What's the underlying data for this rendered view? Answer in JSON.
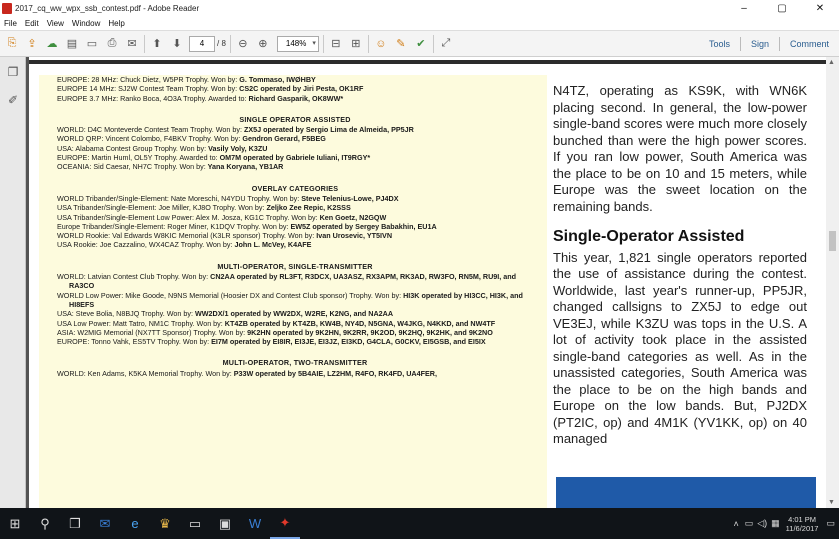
{
  "window": {
    "title": "2017_cq_ww_wpx_ssb_contest.pdf - Adobe Reader",
    "controls": [
      "–",
      "▢",
      "✕"
    ]
  },
  "menu": [
    "File",
    "Edit",
    "View",
    "Window",
    "Help"
  ],
  "toolbar": {
    "page_current": "4",
    "page_total": "/ 8",
    "zoom": "148%",
    "right": [
      "Tools",
      "Sign",
      "Comment"
    ]
  },
  "doc": {
    "left_lines": [
      {
        "type": "line",
        "text": "EUROPE: 28 MHz: Chuck Dietz, W5PR Trophy. Won by: G. Tommaso, IWØHBY"
      },
      {
        "type": "line",
        "text": "EUROPE 14 MHz: SJ2W Contest Team Trophy. Won by: CS2C operated by Jiri Pesta, OK1RF"
      },
      {
        "type": "line",
        "text": "EUROPE 3.7 MHz: Ranko Boca, 4O3A Trophy. Awarded to: Richard Gasparik, OK8WW*"
      },
      {
        "type": "head",
        "text": "SINGLE OPERATOR ASSISTED"
      },
      {
        "type": "line",
        "text": "WORLD: D4C Monteverde Contest Team Trophy. Won by: ZX5J operated by Sergio Lima de Almeida, PP5JR"
      },
      {
        "type": "line",
        "text": "WORLD QRP: Vincent Colombo, F4BKV Trophy. Won by: Gendron Gerard, F5BEG"
      },
      {
        "type": "line",
        "text": "USA: Alabama Contest Group Trophy. Won by: Vasily Voly, K3ZU"
      },
      {
        "type": "line",
        "text": "EUROPE: Martin Huml, OL5Y Trophy. Awarded to: OM7M operated by Gabriele Iuliani, IT9RGY*"
      },
      {
        "type": "line",
        "text": "OCEANIA: Sid Caesar, NH7C Trophy. Won by: Yana Koryana, YB1AR"
      },
      {
        "type": "head",
        "text": "OVERLAY CATEGORIES"
      },
      {
        "type": "line",
        "text": "WORLD Tribander/Single-Element: Nate Moreschi, N4YDU Trophy. Won by: Steve Telenius-Lowe, PJ4DX"
      },
      {
        "type": "line",
        "text": "USA Tribander/Single-Element: Joe Miller, KJ8O Trophy. Won by: Zeljko Zee Repic, K2SSS"
      },
      {
        "type": "line",
        "text": "USA Tribander/Single-Element Low Power: Alex M. Josza, KG1C Trophy. Won by: Ken Goetz, N2GQW"
      },
      {
        "type": "wrap",
        "text": "Europe Tribander/Single-Element: Roger Miner, K1DQV Trophy. Won by: EW5Z operated by Sergey Babakhin, EU1A"
      },
      {
        "type": "line",
        "text": "WORLD Rookie: Val Edwards W8KIC Memorial (K3LR sponsor) Trophy. Won by: Ivan Urosevic, YT5IVN"
      },
      {
        "type": "line",
        "text": "USA Rookie: Joe Cazzalino, WX4CAZ Trophy. Won by: John L. McVey, K4AFE"
      },
      {
        "type": "head",
        "text": "MULTI-OPERATOR, SINGLE-TRANSMITTER"
      },
      {
        "type": "wrap",
        "text": "WORLD: Latvian Contest Club Trophy. Won by: CN2AA operated by RL3FT, R3DCX, UA3ASZ, RX3APM, RK3AD, RW3FO, RN5M, RU9I, and RA3CO"
      },
      {
        "type": "wrap",
        "text": "WORLD Low Power: Mike Goode, N9NS Memorial (Hoosier DX and Contest Club sponsor) Trophy. Won by: HI3K operated by HI3CC, HI3K, and HI8EFS"
      },
      {
        "type": "line",
        "text": "USA: Steve Bolia, N8BJQ Trophy. Won by: WW2DX/1 operated by WW2DX, W2RE, K2NG, and NA2AA"
      },
      {
        "type": "wrap",
        "text": "USA Low Power: Matt Tatro, NM1C Trophy. Won by: KT4ZB operated by KT4ZB, KW4B, NY4D, N5GNA, W4JKG, N4KKD, and NW4TF"
      },
      {
        "type": "wrap",
        "text": "ASIA: W2MIG Memorial (NX7TT Sponsor) Trophy. Won by: 9K2HN operated by 9K2HN, 9K2RR, 9K2OD, 9K2HQ, 9K2HK, and 9K2NO"
      },
      {
        "type": "wrap",
        "text": "EUROPE: Tonno Vahk, ES5TV Trophy. Won by: EI7M operated by EI8IR, EI3JE, EI3JZ, EI3KD, G4CLA, G0CKV, EI5GSB, and EI5IX"
      },
      {
        "type": "head",
        "text": "MULTI-OPERATOR, TWO-TRANSMITTER"
      },
      {
        "type": "line",
        "text": "WORLD: Ken Adams, K5KA Memorial Trophy. Won by: P33W operated by 5B4AIE, LZ2HM, R4FO, RK4FD, UA4FER,"
      }
    ],
    "right_para1": "N4TZ, operating as KS9K, with WN6K placing second. In general, the low-power single-band scores were much more closely bunched than were the high power scores. If you ran low power, South America was the place to be on 10 and 15 meters, while Europe was the sweet location on the remaining bands.",
    "right_heading": "Single-Operator Assisted",
    "right_para2": "This year, 1,821 single operators reported the use of assistance during the contest. Worldwide, last year's runner-up, PP5JR, changed callsigns to ZX5J to edge out VE3EJ, while K3ZU was tops in the U.S. A lot of activity took place in the assisted single-band categories as well. As in the unassisted categories, South America was the place to be on the high bands and Europe on the low bands. But, PJ2DX (PT2IC, op) and 4M1K (YV1KK, op) on 40 managed"
  },
  "taskbar": {
    "time": "4:01 PM",
    "date": "11/6/2017"
  }
}
